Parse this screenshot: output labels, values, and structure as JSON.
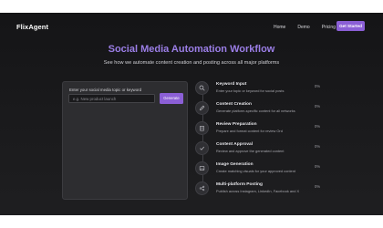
{
  "nav": {
    "logo": "FlixAgent",
    "links": [
      "Home",
      "Demo",
      "Pricing"
    ],
    "cta": "Get Started"
  },
  "hero": {
    "title": "Social Media Automation Workflow",
    "subtitle": "See how we automate content creation and posting across all major platforms"
  },
  "input_panel": {
    "label": "Enter your social media topic or keyword",
    "placeholder": "e.g. New product launch",
    "value": "",
    "button": "Generate"
  },
  "steps": [
    {
      "icon": "search-icon",
      "title": "Keyword Input",
      "desc": "Enter your topic or keyword for social posts",
      "progress": "0%"
    },
    {
      "icon": "pen-icon",
      "title": "Content Creation",
      "desc": "Generate platform-specific content for all networks",
      "progress": "0%"
    },
    {
      "icon": "clipboard-icon",
      "title": "Review Preparation",
      "desc": "Prepare and format content for review Ord",
      "progress": "0%"
    },
    {
      "icon": "check-icon",
      "title": "Content Approval",
      "desc": "Review and approve the generated content",
      "progress": "0%"
    },
    {
      "icon": "image-icon",
      "title": "Image Generation",
      "desc": "Create matching visuals for your approved content",
      "progress": "0%"
    },
    {
      "icon": "share-icon",
      "title": "Multi-platform Posting",
      "desc": "Publish across Instagram, LinkedIn, Facebook and X",
      "progress": "0%"
    }
  ],
  "colors": {
    "accent": "#8b5fd6",
    "title": "#9b7ee6",
    "background": "#1b1b1d"
  }
}
